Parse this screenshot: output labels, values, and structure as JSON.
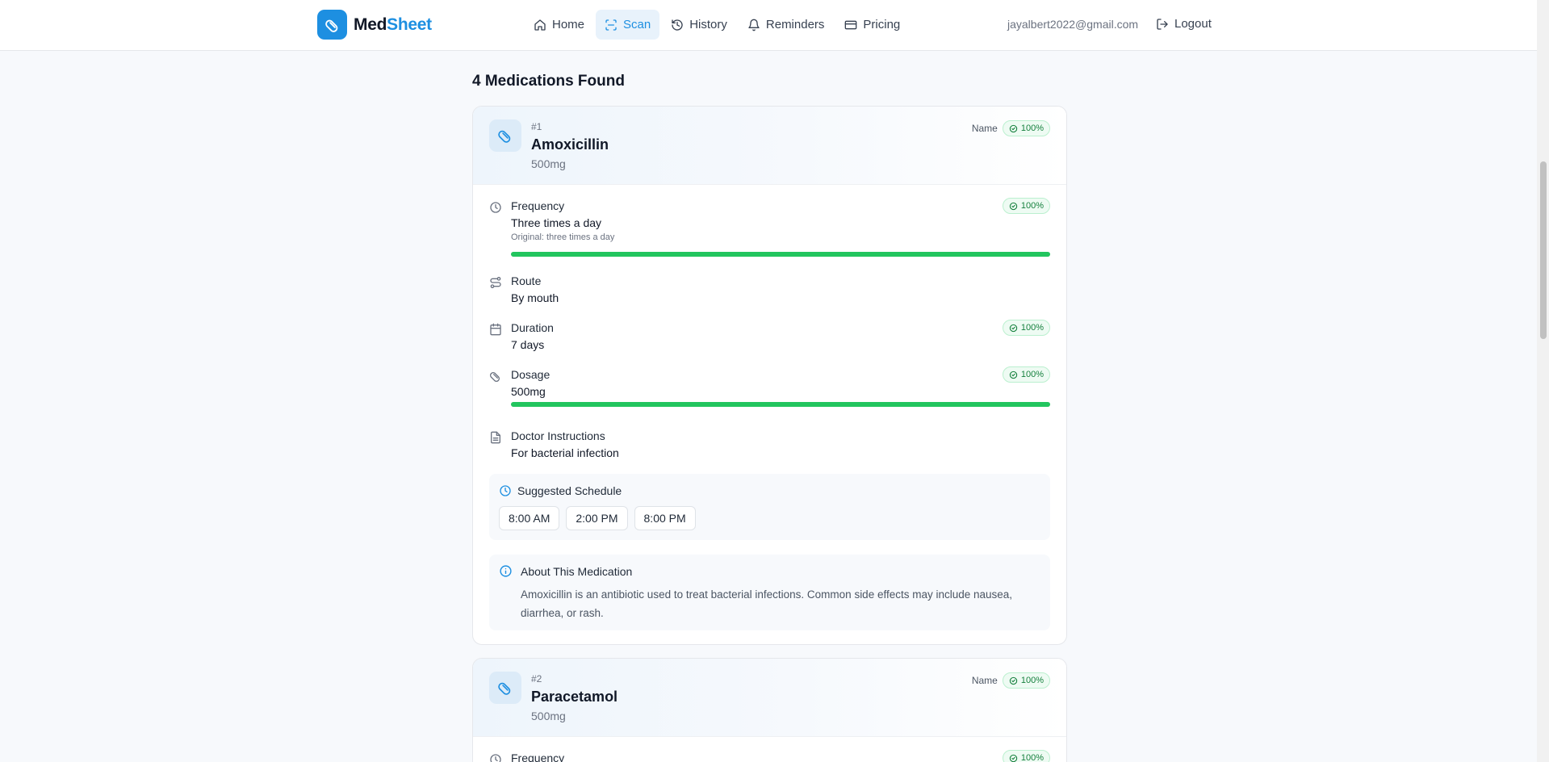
{
  "header": {
    "logo_part1": "Med",
    "logo_part2": "Sheet",
    "nav": [
      {
        "label": "Home",
        "icon": "home-icon"
      },
      {
        "label": "Scan",
        "icon": "scan-icon",
        "active": true
      },
      {
        "label": "History",
        "icon": "history-icon"
      },
      {
        "label": "Reminders",
        "icon": "bell-icon"
      },
      {
        "label": "Pricing",
        "icon": "credit-card-icon"
      }
    ],
    "user_email": "jayalbert2022@gmail.com",
    "logout_label": "Logout"
  },
  "results": {
    "title": "4 Medications Found"
  },
  "medications": [
    {
      "index": "#1",
      "name": "Amoxicillin",
      "strength": "500mg",
      "name_label": "Name",
      "name_confidence": "100%",
      "frequency": {
        "label": "Frequency",
        "value": "Three times a day",
        "original": "Original: three times a day",
        "confidence": "100%",
        "bar": 1.0
      },
      "route": {
        "label": "Route",
        "value": "By mouth"
      },
      "duration": {
        "label": "Duration",
        "value": "7 days",
        "confidence": "100%"
      },
      "dosage": {
        "label": "Dosage",
        "value": "500mg",
        "confidence": "100%",
        "bar": 1.0
      },
      "instructions": {
        "label": "Doctor Instructions",
        "value": "For bacterial infection"
      },
      "schedule": {
        "title": "Suggested Schedule",
        "times": [
          "8:00 AM",
          "2:00 PM",
          "8:00 PM"
        ]
      },
      "about": {
        "title": "About This Medication",
        "text": "Amoxicillin is an antibiotic used to treat bacterial infections. Common side effects may include nausea, diarrhea, or rash."
      }
    },
    {
      "index": "#2",
      "name": "Paracetamol",
      "strength": "500mg",
      "name_label": "Name",
      "name_confidence": "100%",
      "frequency": {
        "label": "Frequency",
        "confidence": "100%"
      }
    }
  ],
  "colors": {
    "brand": "#1d8fe1",
    "success": "#22c55e",
    "success_text": "#15803d"
  }
}
